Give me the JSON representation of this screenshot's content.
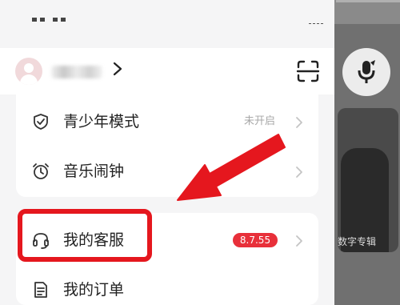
{
  "profile": {
    "username_obscured": "··",
    "chevron_icon": "chevron-right-icon",
    "scan_icon": "scan-icon"
  },
  "menu_group_1": [
    {
      "label": "青少年模式",
      "icon": "shield-check-icon",
      "status": "未开启"
    },
    {
      "label": "音乐闹钟",
      "icon": "alarm-clock-icon"
    }
  ],
  "menu_group_2": [
    {
      "label": "我的客服",
      "icon": "headset-icon",
      "badge": "8.7.55"
    },
    {
      "label": "我的订单",
      "icon": "order-list-icon"
    }
  ],
  "background": {
    "card_caption": "数字专辑",
    "mic_icon": "microphone-icon"
  },
  "annotations": {
    "highlight_color": "#e5171e",
    "arrow_color": "#e5171e"
  },
  "colors": {
    "badge": "#e8303a",
    "text_primary": "#222222",
    "text_secondary": "#a8a8a8",
    "drawer_bg": "#f5f5f6"
  }
}
